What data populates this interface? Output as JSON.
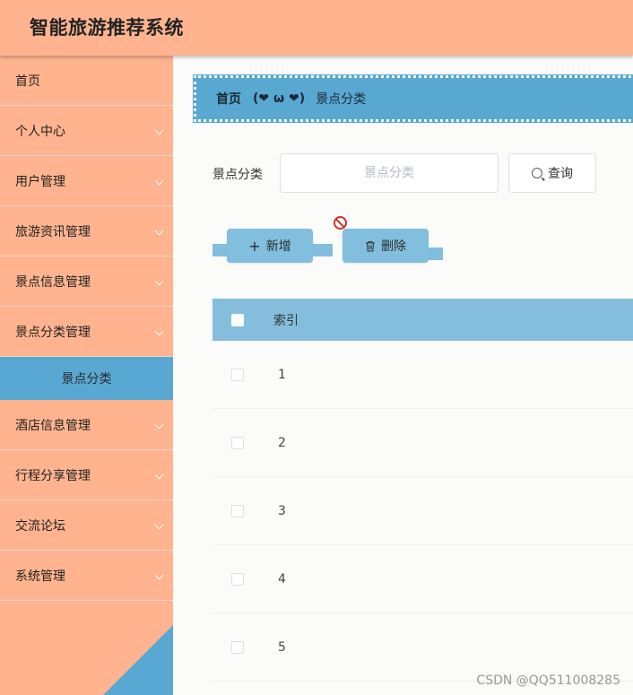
{
  "app": {
    "title": "智能旅游推荐系统"
  },
  "sidebar": {
    "items": [
      {
        "label": "首页",
        "has_arrow": false
      },
      {
        "label": "个人中心",
        "has_arrow": true
      },
      {
        "label": "用户管理",
        "has_arrow": true
      },
      {
        "label": "旅游资讯管理",
        "has_arrow": true
      },
      {
        "label": "景点信息管理",
        "has_arrow": true
      },
      {
        "label": "景点分类管理",
        "has_arrow": true
      },
      {
        "label": "酒店信息管理",
        "has_arrow": true
      },
      {
        "label": "行程分享管理",
        "has_arrow": true
      },
      {
        "label": "交流论坛",
        "has_arrow": true
      },
      {
        "label": "系统管理",
        "has_arrow": true
      }
    ],
    "active_sub": "景点分类"
  },
  "breadcrumb": {
    "home": "首页",
    "separator": "(❤ ω ❤)",
    "current": "景点分类"
  },
  "search": {
    "label": "景点分类",
    "placeholder": "景点分类",
    "value": "",
    "button_label": "查询"
  },
  "toolbar": {
    "add_label": "新增",
    "delete_label": "删除"
  },
  "table": {
    "header": "索引",
    "rows": [
      "1",
      "2",
      "3",
      "4",
      "5"
    ]
  },
  "watermark": "CSDN @QQ511008285",
  "colors": {
    "header_bg": "#ffb48f",
    "accent_blue": "#58a8d2",
    "button_blue": "#82bedd"
  }
}
